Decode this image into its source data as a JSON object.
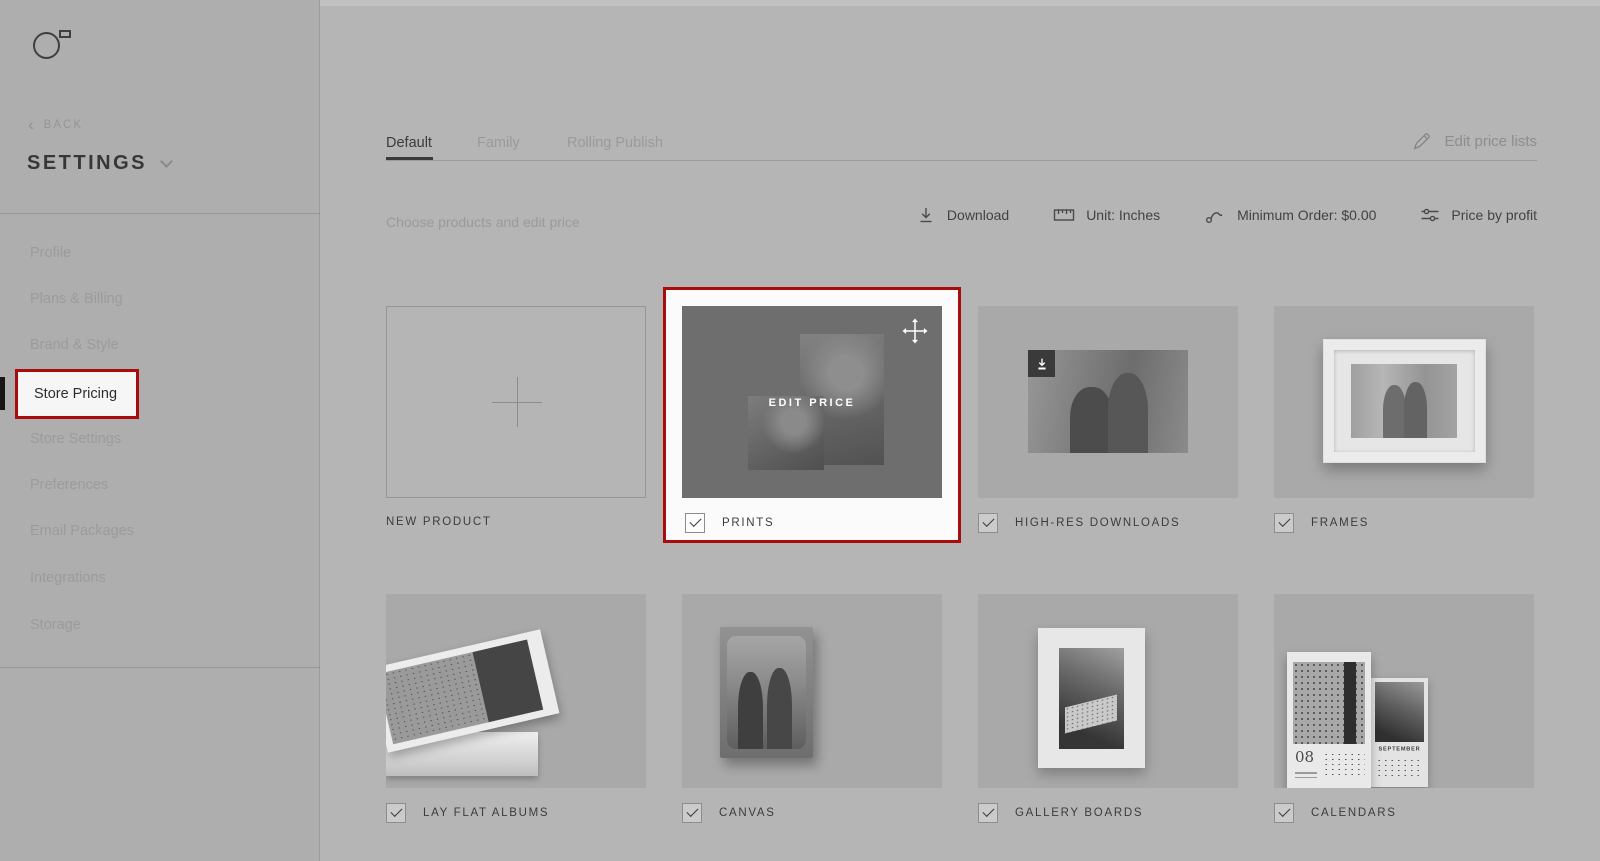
{
  "sidebar": {
    "back_label": "BACK",
    "title": "SETTINGS",
    "items": [
      {
        "label": "Profile",
        "active": false
      },
      {
        "label": "Plans & Billing",
        "active": false
      },
      {
        "label": "Brand & Style",
        "active": false
      },
      {
        "label": "Store Pricing",
        "active": true,
        "highlighted": true
      },
      {
        "label": "Store Settings",
        "active": false
      },
      {
        "label": "Preferences",
        "active": false
      },
      {
        "label": "Email Packages",
        "active": false
      },
      {
        "label": "Integrations",
        "active": false
      },
      {
        "label": "Storage",
        "active": false
      }
    ]
  },
  "header": {
    "tabs": [
      {
        "label": "Default",
        "active": true
      },
      {
        "label": "Family",
        "active": false
      },
      {
        "label": "Rolling Publish",
        "active": false
      }
    ],
    "edit_price_lists": "Edit price lists"
  },
  "toolbar": {
    "hint": "Choose products and edit price",
    "actions": [
      {
        "label": "Download",
        "icon": "download-icon"
      },
      {
        "label": "Unit: Inches",
        "icon": "ruler-icon"
      },
      {
        "label": "Minimum Order: $0.00",
        "icon": "minimum-order-icon"
      },
      {
        "label": "Price by profit",
        "icon": "price-by-profit-icon"
      }
    ]
  },
  "products": {
    "new_product_label": "NEW PRODUCT",
    "hover_action": "EDIT PRICE",
    "row1": [
      {
        "label": "PRINTS",
        "checked": true,
        "highlighted": true
      },
      {
        "label": "HIGH-RES DOWNLOADS",
        "checked": true
      },
      {
        "label": "FRAMES",
        "checked": true
      }
    ],
    "row2": [
      {
        "label": "LAY FLAT ALBUMS",
        "checked": true
      },
      {
        "label": "CANVAS",
        "checked": true
      },
      {
        "label": "GALLERY BOARDS",
        "checked": true
      },
      {
        "label": "CALENDARS",
        "checked": true
      }
    ],
    "calendar": {
      "front_day": "08",
      "back_month": "SEPTEMBER"
    }
  },
  "colors": {
    "highlight_red": "#a80c0c",
    "page_bg": "#b5b5b5",
    "sidebar_bg": "#aeaeae",
    "tile_bg": "#a9a9a9",
    "dark_text": "#3b3b3b",
    "dim_text": "#9a9a9a",
    "card_white": "#fbfbfb"
  }
}
